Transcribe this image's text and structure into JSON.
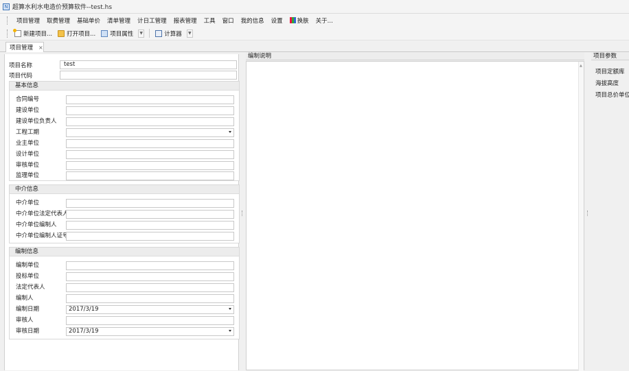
{
  "window": {
    "title": "超算水利水电造价预算软件--test.hs",
    "app_icon": "app-icon"
  },
  "menu": {
    "items": [
      "项目管理",
      "取费管理",
      "基础单价",
      "清单管理",
      "计日工管理",
      "报表管理",
      "工具",
      "窗口",
      "我的信息",
      "设置",
      "换肤",
      "关于..."
    ]
  },
  "toolbar": {
    "new_project": "新建项目...",
    "open_project": "打开项目...",
    "project_props": "项目属性",
    "calculator": "计算器"
  },
  "tabs": {
    "active": "项目管理",
    "close": "×"
  },
  "project": {
    "name_label": "项目名称",
    "name_value": "test",
    "code_label": "项目代码",
    "code_value": ""
  },
  "basic_info": {
    "header": "基本信息",
    "fields": [
      {
        "label": "合同编号",
        "value": ""
      },
      {
        "label": "建设单位",
        "value": ""
      },
      {
        "label": "建设单位负责人",
        "value": ""
      },
      {
        "label": "工程工期",
        "value": ""
      },
      {
        "label": "业主单位",
        "value": ""
      },
      {
        "label": "设计单位",
        "value": ""
      },
      {
        "label": "审核单位",
        "value": ""
      },
      {
        "label": "监理单位",
        "value": ""
      }
    ]
  },
  "agency_info": {
    "header": "中介信息",
    "fields": [
      {
        "label": "中介单位",
        "value": ""
      },
      {
        "label": "中介单位法定代表人",
        "value": ""
      },
      {
        "label": "中介单位编制人",
        "value": ""
      },
      {
        "label": "中介单位编制人证号",
        "value": ""
      }
    ]
  },
  "compile_info": {
    "header": "编制信息",
    "fields": [
      {
        "label": "编制单位",
        "value": ""
      },
      {
        "label": "投标单位",
        "value": ""
      },
      {
        "label": "法定代表人",
        "value": ""
      },
      {
        "label": "编制人",
        "value": ""
      },
      {
        "label": "编制日期",
        "value": "2017/3/19"
      },
      {
        "label": "审核人",
        "value": ""
      },
      {
        "label": "审核日期",
        "value": "2017/3/19"
      }
    ]
  },
  "description_panel": {
    "header": "编制说明"
  },
  "params_panel": {
    "header": "项目参数",
    "items": [
      "项目定额库",
      "海拔高度",
      "项目总价单位"
    ]
  }
}
